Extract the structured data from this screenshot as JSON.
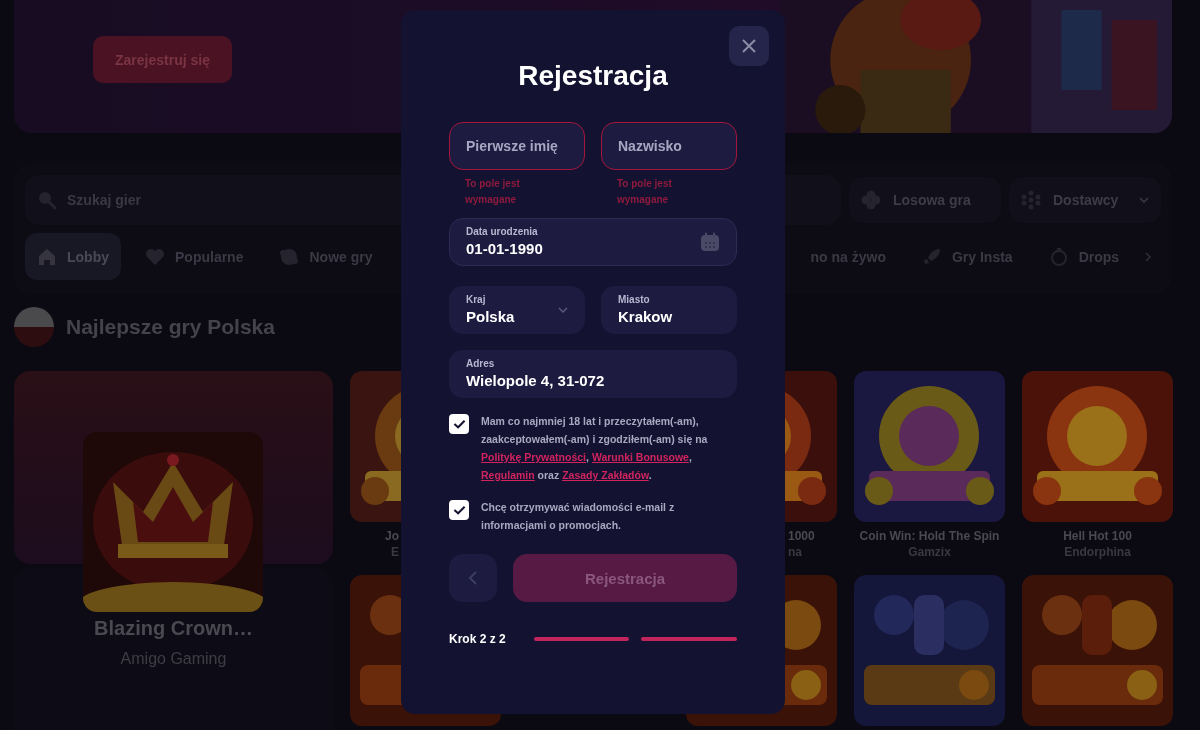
{
  "banner": {
    "register_button": "Zarejestruj się"
  },
  "search": {
    "placeholder": "Szukaj gier"
  },
  "random_button": "Losowa gra",
  "providers_dropdown": "Dostawcy",
  "categories": [
    {
      "label": "Lobby",
      "selected": true
    },
    {
      "label": "Popularne",
      "selected": false
    },
    {
      "label": "Nowe gry",
      "selected": false
    },
    {
      "label": "no na żywo",
      "selected": false
    },
    {
      "label": "Gry Insta",
      "selected": false
    },
    {
      "label": "Drops",
      "selected": false
    }
  ],
  "section": {
    "title": "Najlepsze gry Polska"
  },
  "featured_game": {
    "title": "Blazing Crown…",
    "provider": "Amigo Gaming"
  },
  "games": [
    {
      "title": "Jo",
      "provider": "E"
    },
    {
      "title": "1000",
      "provider": "na"
    },
    {
      "title": "Coin Win: Hold The Spin",
      "provider": "Gamzix"
    },
    {
      "title": "Hell Hot 100",
      "provider": "Endorphina"
    }
  ],
  "modal": {
    "title": "Rejestracja",
    "name_fields": [
      {
        "placeholder": "Pierwsze imię",
        "error": "To pole jest wymagane"
      },
      {
        "placeholder": "Nazwisko",
        "error": "To pole jest wymagane"
      }
    ],
    "birth_date": {
      "label": "Data urodzenia",
      "value": "01-01-1990"
    },
    "country": {
      "label": "Kraj",
      "value": "Polska"
    },
    "city": {
      "label": "Miasto",
      "value": "Krakow"
    },
    "address": {
      "label": "Adres",
      "value": "Wielopole 4, 31-072"
    },
    "consents": [
      {
        "checked": true,
        "parts": [
          {
            "kind": "text",
            "text": "Mam co najmniej 18 lat i przeczytałem(-am), zaakceptowałem(-am) i zgodziłem(-am) się na "
          },
          {
            "kind": "link",
            "text": "Politykę Prywatności"
          },
          {
            "kind": "text",
            "text": ", "
          },
          {
            "kind": "link",
            "text": "Warunki Bonusowe"
          },
          {
            "kind": "text",
            "text": ", "
          },
          {
            "kind": "link",
            "text": "Regulamin"
          },
          {
            "kind": "text",
            "text": " oraz "
          },
          {
            "kind": "link",
            "text": "Zasady Zakładów"
          },
          {
            "kind": "text",
            "text": "."
          }
        ]
      },
      {
        "checked": true,
        "parts": [
          {
            "kind": "text",
            "text": "Chcę otrzymywać wiadomości e-mail z informacjami o promocjach."
          }
        ]
      }
    ],
    "submit": {
      "label": "Rejestracja",
      "disabled": true
    },
    "step": "Krok 2 z 2",
    "steps": [
      {
        "completed": true
      },
      {
        "completed": true
      }
    ]
  }
}
